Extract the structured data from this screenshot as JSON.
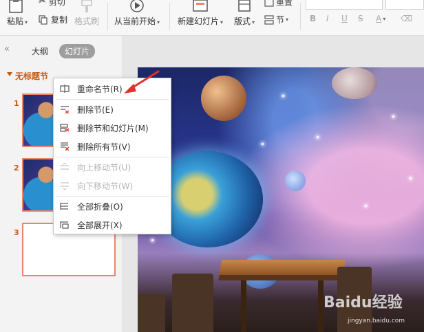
{
  "ribbon": {
    "paste": "粘贴",
    "cut": "剪切",
    "copy": "复制",
    "format_painter": "格式刷",
    "from_current": "从当前开始",
    "new_slide": "新建幻灯片",
    "layout": "版式",
    "section": "节",
    "reset": "重置"
  },
  "panel": {
    "tab_outline": "大纲",
    "tab_slides": "幻灯片",
    "section_name": "无标题节",
    "slides": [
      "1",
      "2",
      "3"
    ]
  },
  "context_menu": {
    "items": [
      {
        "label": "重命名节(R)",
        "enabled": true
      },
      {
        "label": "删除节(E)",
        "enabled": true
      },
      {
        "label": "删除节和幻灯片(M)",
        "enabled": true
      },
      {
        "label": "删除所有节(V)",
        "enabled": true
      },
      {
        "label": "向上移动节(U)",
        "enabled": false
      },
      {
        "label": "向下移动节(W)",
        "enabled": false
      },
      {
        "label": "全部折叠(O)",
        "enabled": true
      },
      {
        "label": "全部展开(X)",
        "enabled": true
      }
    ]
  },
  "watermark": {
    "brand": "Baidu经验",
    "url": "jingyan.baidu.com"
  },
  "colors": {
    "accent": "#c55a11",
    "thumb_border": "#e8866a",
    "arrow": "#e0322a"
  }
}
